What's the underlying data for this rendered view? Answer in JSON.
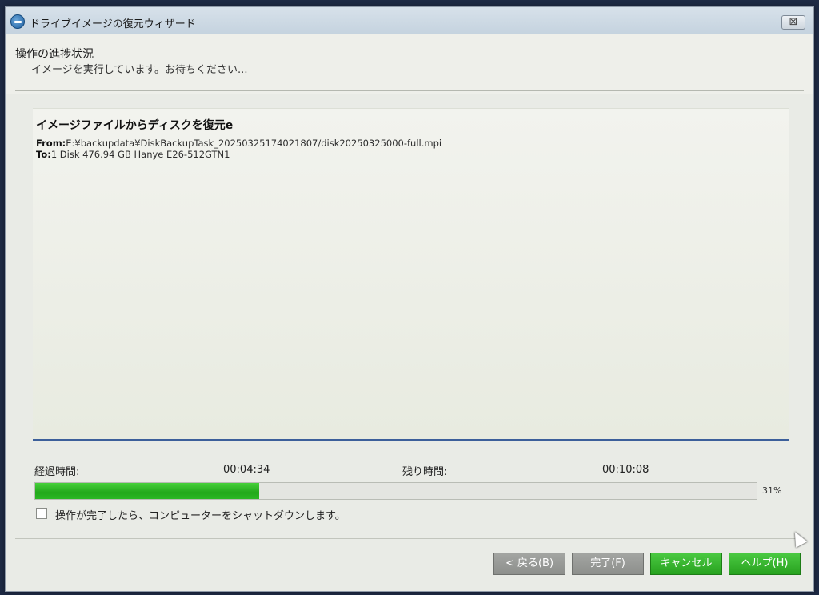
{
  "window": {
    "title": "ドライブイメージの復元ウィザード",
    "close_glyph": "⊠"
  },
  "header": {
    "title": "操作の進捗状況",
    "subtitle": "イメージを実行しています。お待ちください..."
  },
  "panel": {
    "title": "イメージファイルからディスクを復元e",
    "from_label": "From:",
    "from_value": "E:¥backupdata¥DiskBackupTask_20250325174021807/disk20250325000-full.mpi",
    "to_label": "To:",
    "to_value": "1 Disk 476.94 GB Hanye E26-512GTN1"
  },
  "progress": {
    "elapsed_label": "経過時間:",
    "elapsed_value": "00:04:34",
    "remaining_label": "残り時間:",
    "remaining_value": "00:10:08",
    "percent": 31,
    "percent_text": "31%",
    "fill_color": "#2bb824"
  },
  "shutdown_option": {
    "label": "操作が完了したら、コンピューターをシャットダウンします。",
    "checked": false
  },
  "buttons": {
    "back": "< 戻る(B)",
    "finish": "完了(F)",
    "cancel": "キャンセル",
    "help": "ヘルプ(H)"
  }
}
